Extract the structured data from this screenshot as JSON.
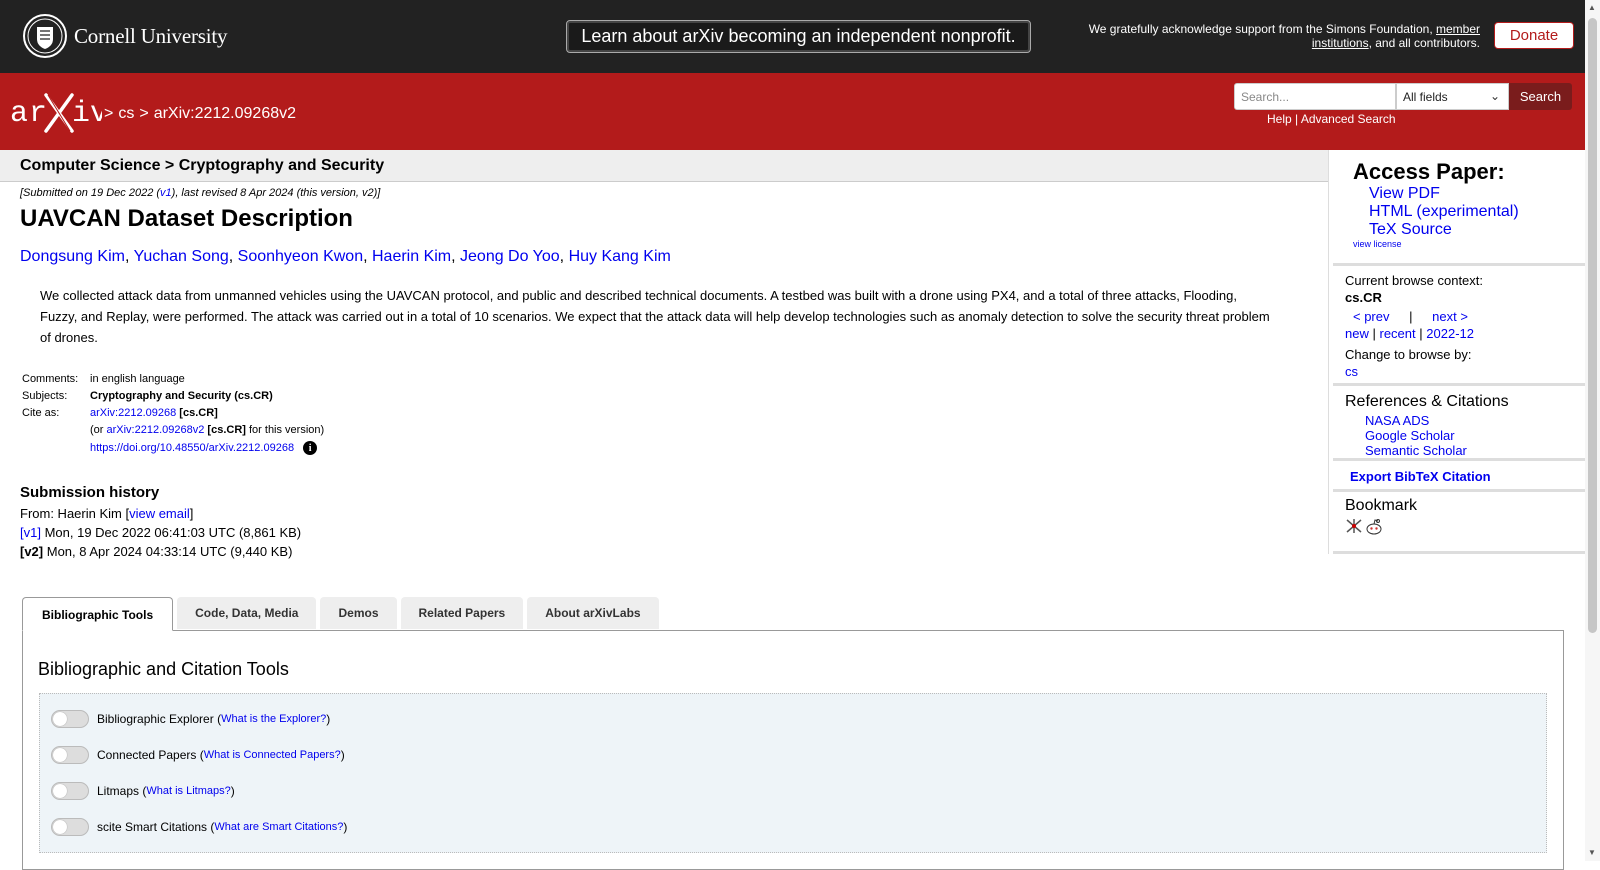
{
  "banner": {
    "university": "Cornell University",
    "nonprofit_notice": "Learn about arXiv becoming an independent nonprofit.",
    "support_prefix": "We gratefully acknowledge support from the Simons Foundation, ",
    "support_link": "member institutions",
    "support_suffix": ", and all contributors.",
    "donate": "Donate"
  },
  "header": {
    "crumb_sep": ">",
    "crumb_cs": "cs",
    "crumb_id": "arXiv:2212.09268v2",
    "search_placeholder": "Search...",
    "search_field": "All fields",
    "search_button": "Search",
    "help": "Help",
    "help_sep": "|",
    "advanced": "Advanced Search"
  },
  "paper": {
    "subject_heading": "Computer Science > Cryptography and Security",
    "dateline_prefix": "[Submitted on 19 Dec 2022 (",
    "dateline_v1": "v1",
    "dateline_suffix": "), last revised 8 Apr 2024 (this version, v2)]",
    "title": "UAVCAN Dataset Description",
    "authors": [
      "Dongsung Kim",
      "Yuchan Song",
      "Soonhyeon Kwon",
      "Haerin Kim",
      "Jeong Do Yoo",
      "Huy Kang Kim"
    ],
    "abstract": "We collected attack data from unmanned vehicles using the UAVCAN protocol, and public and described technical documents. A testbed was built with a drone using PX4, and a total of three attacks, Flooding, Fuzzy, and Replay, were performed. The attack was carried out in a total of 10 scenarios. We expect that the attack data will help develop technologies such as anomaly detection to solve the security threat problem of drones.",
    "comments_label": "Comments:",
    "comments": "in english language",
    "subjects_label": "Subjects:",
    "subjects": "Cryptography and Security (cs.CR)",
    "cite_label": "Cite as:",
    "cite_id": "arXiv:2212.09268",
    "cite_cat": "[cs.CR]",
    "cite_or": "(or ",
    "cite_v2": "arXiv:2212.09268v2",
    "cite_v2_cat": "[cs.CR]",
    "cite_v2_suffix": " for this version)",
    "doi": "https://doi.org/10.48550/arXiv.2212.09268",
    "info_icon": "i"
  },
  "history": {
    "title": "Submission history",
    "from": "From: Haerin Kim [",
    "view_email": "view email",
    "from_close": "]",
    "v1_label": "[v1]",
    "v1_text": " Mon, 19 Dec 2022 06:41:03 UTC (8,861 KB)",
    "v2_label": "[v2]",
    "v2_text": " Mon, 8 Apr 2024 04:33:14 UTC (9,440 KB)"
  },
  "sidebar": {
    "access_title": "Access Paper:",
    "view_pdf": "View PDF",
    "html": "HTML (experimental)",
    "tex": "TeX Source",
    "license": "view license",
    "context_label": "Current browse context:",
    "context": "cs.CR",
    "prev": "< prev",
    "pipe": "|",
    "next": "next >",
    "new": "new",
    "recent": "recent",
    "month": "2022-12",
    "change_label": "Change to browse by:",
    "cs": "cs",
    "refs_title": "References & Citations",
    "nasa": "NASA ADS",
    "google": "Google Scholar",
    "semantic": "Semantic Scholar",
    "bibtex": "Export BibTeX Citation",
    "bookmark_title": "Bookmark"
  },
  "tabs": [
    "Bibliographic Tools",
    "Code, Data, Media",
    "Demos",
    "Related Papers",
    "About arXivLabs"
  ],
  "tools": {
    "panel_title": "Bibliographic and Citation Tools",
    "items": [
      {
        "label": "Bibliographic Explorer",
        "help": "What is the Explorer?"
      },
      {
        "label": "Connected Papers",
        "help": "What is Connected Papers?"
      },
      {
        "label": "Litmaps",
        "help": "What is Litmaps?"
      },
      {
        "label": "scite Smart Citations",
        "help": "What are Smart Citations?"
      }
    ]
  },
  "colors": {
    "brand_red": "#b31b1b",
    "banner_dark": "#222222",
    "link": "#0000ee"
  }
}
